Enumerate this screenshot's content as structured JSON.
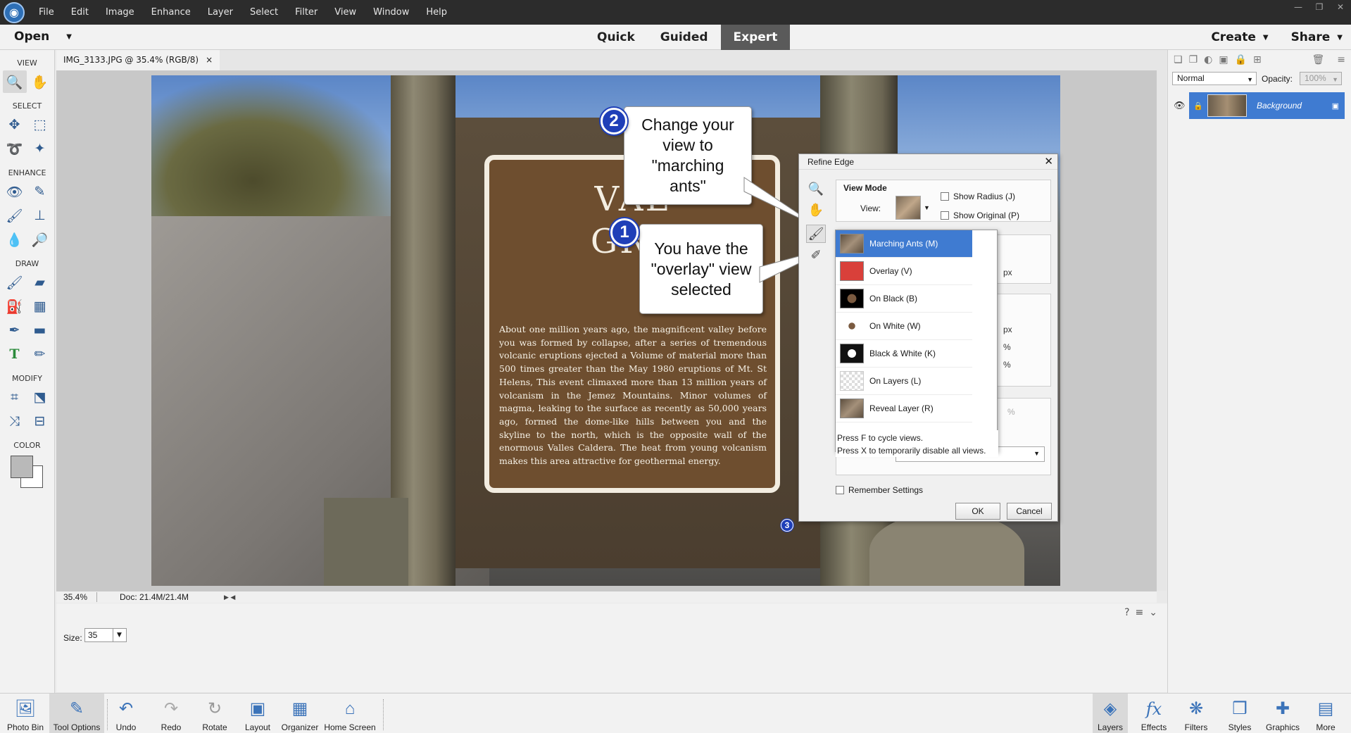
{
  "menu": [
    "File",
    "Edit",
    "Image",
    "Enhance",
    "Layer",
    "Select",
    "Filter",
    "View",
    "Window",
    "Help"
  ],
  "modebar": {
    "open_label": "Open",
    "modes": [
      {
        "label": "Quick"
      },
      {
        "label": "Guided"
      },
      {
        "label": "Expert",
        "active": true
      }
    ],
    "create_label": "Create",
    "share_label": "Share"
  },
  "toolbox": {
    "view_label": "VIEW",
    "select_label": "SELECT",
    "enhance_label": "ENHANCE",
    "draw_label": "DRAW",
    "modify_label": "MODIFY",
    "color_label": "COLOR"
  },
  "document": {
    "tab_title": "IMG_3133.JPG @ 35.4% (RGB/8)",
    "close_glyph": "×"
  },
  "photo": {
    "plaque_title_1": "VAL",
    "plaque_title_2": "GRA",
    "plaque_text": "About one million years ago, the magnificent valley before you was formed by collapse, after a series of tremendous volcanic eruptions ejected a Volume of material more than 500 times greater than the May 1980 eruptions of Mt. St Helens, This event climaxed more than 13 million years of volcanism in the Jemez Mountains. Minor volumes of magma, leaking to the surface as recently as 50,000 years ago, formed the dome-like hills between you and the skyline to the north, which is the opposite wall of the enormous Valles Caldera. The heat from young volcanism makes this area attractive for geothermal energy."
  },
  "callouts": {
    "one": {
      "number": "1",
      "text": "You have the \"overlay\" view selected"
    },
    "two": {
      "number": "2",
      "text": "Change your view to \"marching ants\""
    },
    "three": {
      "number": "3"
    }
  },
  "dialog": {
    "title": "Refine Edge",
    "close_glyph": "✕",
    "view_mode_title": "View Mode",
    "view_label": "View:",
    "show_radius": "Show Radius (J)",
    "show_original": "Show Original (P)",
    "unit_px_1": "px",
    "unit_px_2": "px",
    "unit_pct_1": "%",
    "unit_pct_2": "%",
    "unit_pct_3": "%",
    "remember_settings": "Remember Settings",
    "ok_label": "OK",
    "cancel_label": "Cancel",
    "view_options": [
      {
        "label": "Marching Ants (M)",
        "selected": true,
        "thumb_color": "#8a7761"
      },
      {
        "label": "Overlay (V)",
        "selected": false,
        "thumb_color": "#d9403a"
      },
      {
        "label": "On Black (B)",
        "selected": false,
        "thumb_color": "#000000"
      },
      {
        "label": "On White (W)",
        "selected": false,
        "thumb_color": "#ffffff"
      },
      {
        "label": "Black & White (K)",
        "selected": false,
        "thumb_color": "#111111"
      },
      {
        "label": "On Layers (L)",
        "selected": false,
        "thumb_color": "#cfcfcf"
      },
      {
        "label": "Reveal Layer (R)",
        "selected": false,
        "thumb_color": "#7a6a55"
      }
    ],
    "hint_line_1": "Press F to cycle views.",
    "hint_line_2": "Press X to temporarily disable all views."
  },
  "statusbar": {
    "zoom": "35.4%",
    "doc_size": "Doc: 21.4M/21.4M"
  },
  "tool_options": {
    "size_label": "Size:",
    "size_value": "35"
  },
  "layers_panel": {
    "blend_mode": "Normal",
    "opacity_label": "Opacity:",
    "opacity_value": "100%",
    "layer_name": "Background"
  },
  "bottombar": {
    "photo_bin": "Photo Bin",
    "tool_options": "Tool Options",
    "undo": "Undo",
    "redo": "Redo",
    "rotate": "Rotate",
    "layout": "Layout",
    "organizer": "Organizer",
    "home_screen": "Home Screen",
    "layers": "Layers",
    "effects": "Effects",
    "filters": "Filters",
    "styles": "Styles",
    "graphics": "Graphics",
    "more": "More"
  },
  "colors": {
    "accent_blue": "#3f7bd1",
    "badge_blue": "#1f3fb8",
    "menubar_bg": "#2c2c2c"
  }
}
